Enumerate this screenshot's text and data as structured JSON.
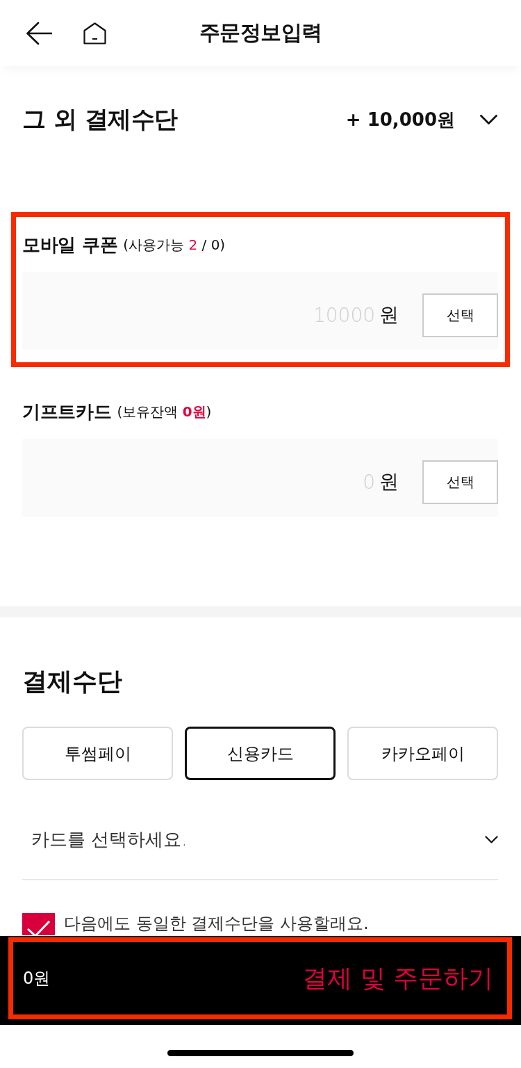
{
  "header": {
    "title": "주문정보입력"
  },
  "other_payments": {
    "title": "그 외 결제수단",
    "total": "+ 10,000원"
  },
  "sections": [
    {
      "title": "모바일 쿠폰",
      "note_before": "(사용가능 ",
      "note_highlight": "2",
      "note_after": " / 0)",
      "highlight_bold": false,
      "placeholder": "10000",
      "unit": "원",
      "button": "선택",
      "highlighted": true
    },
    {
      "title": "기프트카드",
      "note_before": "(보유잔액 ",
      "note_highlight": "0원",
      "note_after": ")",
      "highlight_bold": true,
      "placeholder": "0",
      "unit": "원",
      "button": "선택"
    }
  ],
  "payment": {
    "title": "결제수단",
    "methods": [
      {
        "label": "투썸페이",
        "selected": false
      },
      {
        "label": "신용카드",
        "selected": true
      },
      {
        "label": "카카오페이",
        "selected": false
      }
    ],
    "card_select": {
      "prompt": "카드를 선택하세요."
    },
    "remember": {
      "label": "다음에도 동일한 결제수단을 사용할래요.",
      "checked": true
    }
  },
  "footer": {
    "amount": "0원",
    "action": "결제 및 주문하기",
    "highlighted": true
  }
}
